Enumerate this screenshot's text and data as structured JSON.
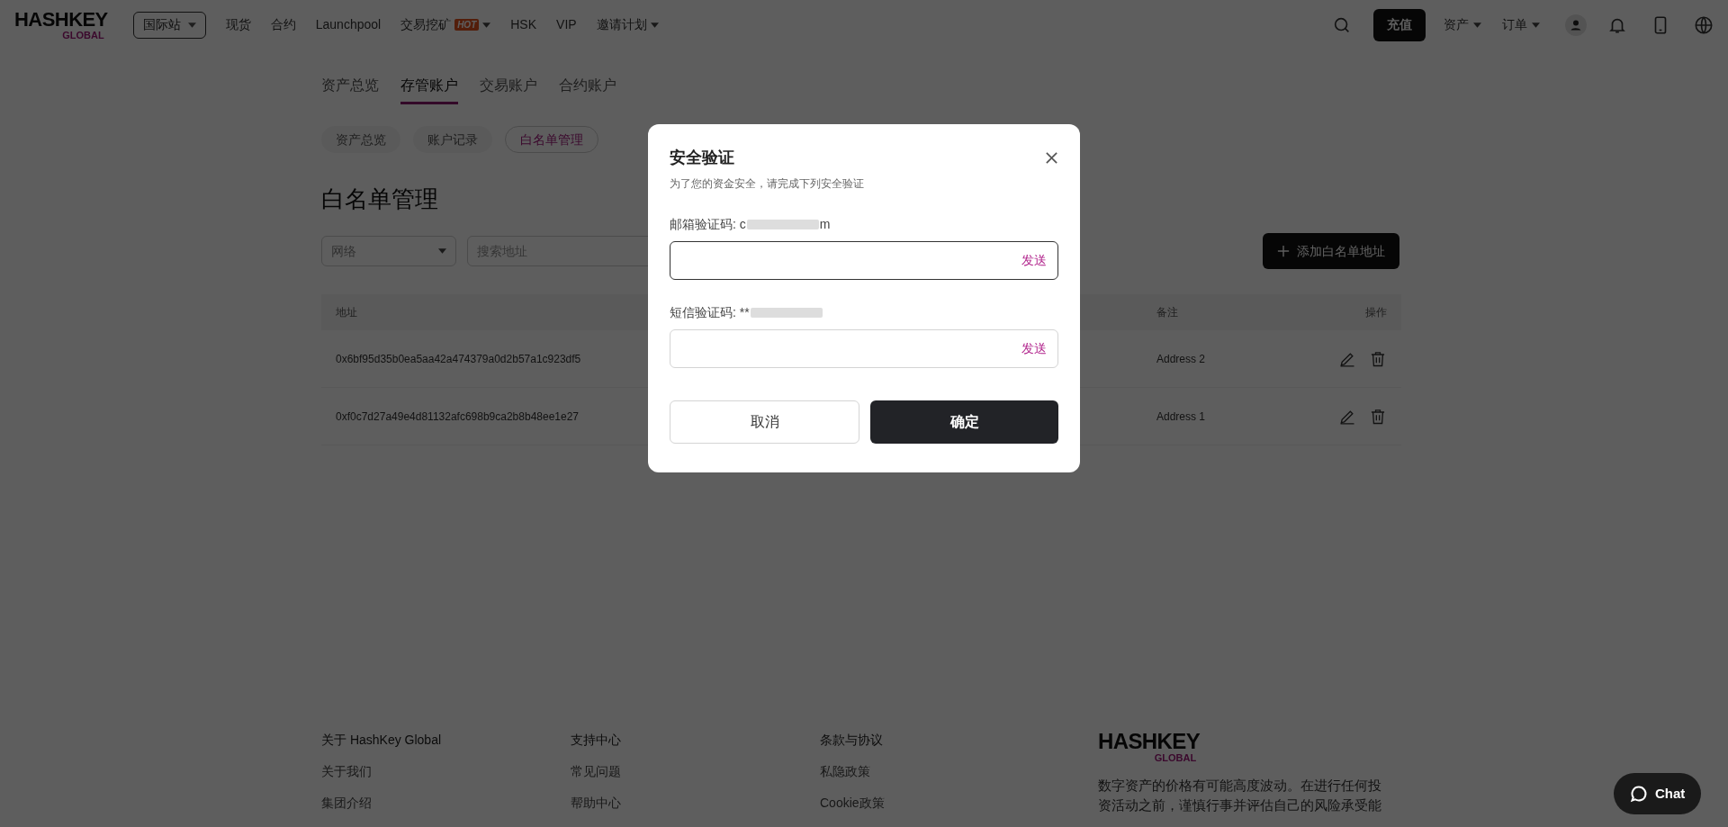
{
  "header": {
    "logo": {
      "word": "HASHKEY",
      "sub": "GLOBAL"
    },
    "region": "国际站",
    "nav": [
      {
        "label": "现货",
        "dropdown": false
      },
      {
        "label": "合约",
        "dropdown": false
      },
      {
        "label": "Launchpool",
        "dropdown": false
      },
      {
        "label": "交易挖矿",
        "badge": "HOT",
        "dropdown": true
      },
      {
        "label": "HSK",
        "dropdown": false
      },
      {
        "label": "VIP",
        "dropdown": false
      },
      {
        "label": "邀请计划",
        "dropdown": true
      }
    ],
    "deposit": "充值",
    "menus": [
      "资产",
      "订单"
    ]
  },
  "account_tabs": [
    {
      "label": "资产总览",
      "selected": false
    },
    {
      "label": "存管账户",
      "selected": true
    },
    {
      "label": "交易账户",
      "selected": false
    },
    {
      "label": "合约账户",
      "selected": false
    }
  ],
  "sub_tabs": [
    {
      "label": "资产总览",
      "selected": false
    },
    {
      "label": "账户记录",
      "selected": false
    },
    {
      "label": "白名单管理",
      "selected": true
    }
  ],
  "page_title": "白名单管理",
  "filters": {
    "network_placeholder": "网络",
    "search_placeholder": "搜索地址"
  },
  "add_button": "添加白名单地址",
  "table": {
    "columns": [
      "地址",
      "备注",
      "操作"
    ],
    "rows": [
      {
        "address": "0x6bf95d35b0ea5aa42a474379a0d2b57a1c923df5",
        "note": "Address 2"
      },
      {
        "address": "0xf0c7d27a49e4d81132afc698b9ca2b8b48ee1e27",
        "note": "Address 1"
      }
    ]
  },
  "dialog": {
    "title": "安全验证",
    "subtitle": "为了您的资金安全，请完成下列安全验证",
    "fields": [
      {
        "label": "邮箱验证码: c",
        "label_end": "m",
        "action": "发送",
        "focused": true
      },
      {
        "label": "短信验证码: **",
        "action": "发送",
        "focused": false
      }
    ],
    "cancel": "取消",
    "confirm": "确定"
  },
  "footer": {
    "columns": [
      {
        "heading": "关于 HashKey Global",
        "links": [
          "关于我们",
          "集团介绍"
        ]
      },
      {
        "heading": "支持中心",
        "links": [
          "常见问题",
          "帮助中心"
        ]
      },
      {
        "heading": "条款与协议",
        "links": [
          "私隐政策",
          "Cookie政策"
        ]
      }
    ],
    "logo": {
      "word": "HASHKEY",
      "sub": "GLOBAL"
    },
    "disclaimer": "数字资产的价格有可能高度波动。在进行任何投资活动之前，谨慎行事并评估自己的风险承受能"
  },
  "chat": "Chat"
}
